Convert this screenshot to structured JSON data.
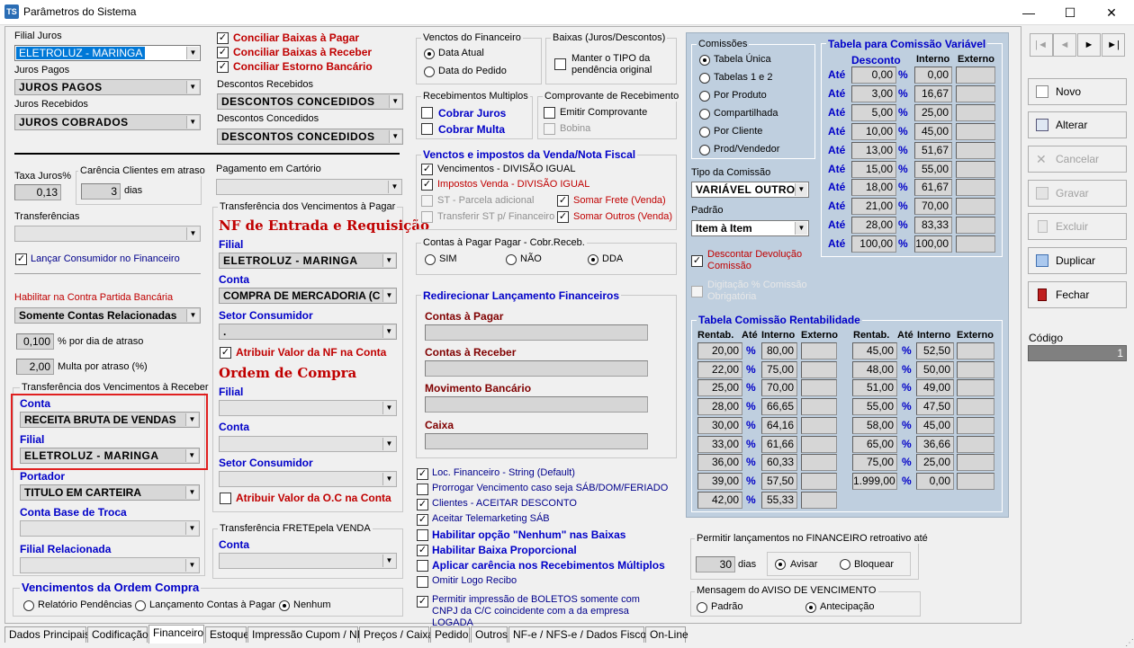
{
  "window": {
    "title": "Parâmetros do Sistema",
    "icon": "TS"
  },
  "left": {
    "filial_juros_label": "Filial Juros",
    "filial_juros": "ELETROLUZ - MARINGA",
    "juros_pagos_label": "Juros Pagos",
    "juros_pagos": "JUROS PAGOS",
    "juros_recebidos_label": "Juros Recebidos",
    "juros_recebidos": "JUROS COBRADOS",
    "conc_pagar": "Conciliar Baixas à Pagar",
    "conc_receber": "Conciliar Baixas à Receber",
    "conc_estorno": "Conciliar Estorno Bancário",
    "desc_recebidos_label": "Descontos Recebidos",
    "desc_recebidos": "DESCONTOS CONCEDIDOS",
    "desc_concedidos_label": "Descontos Concedidos",
    "desc_concedidos": "DESCONTOS CONCEDIDOS",
    "taxa_juros_label": "Taxa Juros%",
    "taxa_juros": "0,13",
    "carencia_label": "Carência Clientes em atraso",
    "carencia": "3",
    "carencia_unit": "dias",
    "pag_cartorio_label": "Pagamento em Cartório",
    "transferencias_label": "Transferências",
    "lancar_consumidor": "Lançar Consumidor no Financeiro",
    "habilitar_contra_label": "Habilitar na Contra Partida Bancária",
    "habilitar_contra": "Somente Contas Relacionadas",
    "por_dia": "0,100",
    "por_dia_label": "% por dia de atraso",
    "multa": "2,00",
    "multa_label": "Multa por atraso (%)",
    "transf_receber_label": "Transferência dos Vencimentos à Receber",
    "conta_label": "Conta",
    "conta": "RECEITA BRUTA DE VENDAS",
    "filial_label": "Filial",
    "filial": "ELETROLUZ - MARINGA",
    "portador_label": "Portador",
    "portador": "TITULO EM CARTEIRA",
    "conta_base_label": "Conta Base de Troca",
    "filial_rel_label": "Filial Relacionada",
    "venc_oc_label": "Vencimentos da Ordem Compra",
    "venc_oc_opts": [
      "Relatório Pendências",
      "Lançamento Contas à Pagar",
      "Nenhum"
    ]
  },
  "pagar": {
    "caption": "Transferência dos Vencimentos à Pagar",
    "nf_title": "NF de Entrada e Requisição",
    "filial_label": "Filial",
    "filial": "ELETROLUZ - MARINGA",
    "conta_label": "Conta",
    "conta": "COMPRA DE MERCADORIA (C",
    "setor_label": "Setor Consumidor",
    "setor": ".",
    "atribuir_nf": "Atribuir Valor da NF na Conta",
    "oc_title": "Ordem de Compra",
    "oc_filial_label": "Filial",
    "oc_conta_label": "Conta",
    "oc_setor_label": "Setor Consumidor",
    "atribuir_oc": "Atribuir Valor da O.C na Conta",
    "frete_caption": "Transferência FRETEpela VENDA",
    "frete_conta_label": "Conta"
  },
  "mid": {
    "venctos_fin": "Venctos do Financeiro",
    "data_atual": "Data Atual",
    "data_pedido": "Data do Pedido",
    "baixas": "Baixas (Juros/Descontos)",
    "manter_tipo": "Manter o TIPO da pendência original",
    "receb_mult": "Recebimentos Multiplos",
    "cobrar_juros": "Cobrar Juros",
    "cobrar_multa": "Cobrar Multa",
    "comprov": "Comprovante de Recebimento",
    "emitir_comp": "Emitir Comprovante",
    "bobina": "Bobina",
    "venctos_impostos": "Venctos e impostos da Venda/Nota Fiscal",
    "vencimentos": "Vencimentos - DIVISÃO IGUAL",
    "impostos": "Impostos Venda - DIVISÃO IGUAL",
    "st_parcela": "ST - Parcela adicional",
    "somar_frete": "Somar Frete (Venda)",
    "transf_st": "Transferir ST p/ Financeiro",
    "somar_outros": "Somar Outros (Venda)",
    "contas_pagar_cobr": "Contas à Pagar Pagar - Cobr.Receb.",
    "sim": "SIM",
    "nao": "NÃO",
    "dda": "DDA",
    "redirecionar": "Redirecionar Lançamento Financeiros",
    "contas_pagar": "Contas à Pagar",
    "contas_receber": "Contas à Receber",
    "mov_bancario": "Movimento Bancário",
    "caixa": "Caixa",
    "checks": [
      "Loc. Financeiro - String (Default)",
      "Prorrogar Vencimento caso seja SÁB/DOM/FERIADO",
      "Clientes - ACEITAR DESCONTO",
      "Aceitar Telemarketing SÁB",
      "Habilitar opção \"Nenhum\" nas Baixas",
      "Habilitar Baixa Proporcional",
      "Aplicar carência nos Recebimentos Múltiplos",
      "Omitir Logo Recibo"
    ],
    "boletos": "Permitir impressão de BOLETOS somente com CNPJ da C/C coincidente com a da  empresa LOGADA"
  },
  "comissao": {
    "caption": "Comissões",
    "opts": [
      "Tabela Única",
      "Tabelas 1 e 2",
      "Por Produto",
      "Compartilhada",
      "Por Cliente",
      "Prod/Vendedor"
    ],
    "tipo_label": "Tipo da Comissão",
    "tipo": "VARIÁVEL OUTRO",
    "padrao_label": "Padrão",
    "padrao": "Item à Item",
    "descontar": "Descontar Devolução Comissão",
    "digitacao": "Digitação % Comissão Obrigatória",
    "var_title": "Tabela para Comissão Variável",
    "h_desc": "Desconto",
    "h_int": "Interno",
    "h_ext": "Externo",
    "ate": "Até",
    "pct": "%",
    "rows": [
      [
        "0,00",
        "0,00"
      ],
      [
        "3,00",
        "16,67"
      ],
      [
        "5,00",
        "25,00"
      ],
      [
        "10,00",
        "45,00"
      ],
      [
        "13,00",
        "51,67"
      ],
      [
        "15,00",
        "55,00"
      ],
      [
        "18,00",
        "61,67"
      ],
      [
        "21,00",
        "70,00"
      ],
      [
        "28,00",
        "83,33"
      ],
      [
        "100,00",
        "100,00"
      ]
    ],
    "rent_title": "Tabela Comissão Rentabilidade",
    "h_rent": "Rentab.",
    "rent_left": [
      [
        "20,00",
        "80,00"
      ],
      [
        "22,00",
        "75,00"
      ],
      [
        "25,00",
        "70,00"
      ],
      [
        "28,00",
        "66,65"
      ],
      [
        "30,00",
        "64,16"
      ],
      [
        "33,00",
        "61,66"
      ],
      [
        "36,00",
        "60,33"
      ],
      [
        "39,00",
        "57,50"
      ],
      [
        "42,00",
        "55,33"
      ]
    ],
    "rent_right": [
      [
        "45,00",
        "52,50"
      ],
      [
        "48,00",
        "50,00"
      ],
      [
        "51,00",
        "49,00"
      ],
      [
        "55,00",
        "47,50"
      ],
      [
        "58,00",
        "45,00"
      ],
      [
        "65,00",
        "36,66"
      ],
      [
        "75,00",
        "25,00"
      ],
      [
        "1.999,00",
        "0,00"
      ]
    ],
    "retro_label": "Permitir lançamentos no FINANCEIRO retroativo até",
    "retro": "30",
    "retro_unit": "dias",
    "avisar": "Avisar",
    "bloquear": "Bloquear",
    "aviso_label": "Mensagem do AVISO DE VENCIMENTO",
    "padrao_opt": "Padrão",
    "antecip": "Antecipação"
  },
  "buttons": {
    "novo": "Novo",
    "alterar": "Alterar",
    "cancelar": "Cancelar",
    "gravar": "Gravar",
    "excluir": "Excluir",
    "duplicar": "Duplicar",
    "fechar": "Fechar",
    "codigo_label": "Código",
    "codigo": "1"
  },
  "nav": [
    "|◄",
    "◄",
    "►",
    "►|"
  ],
  "tabs": [
    "Dados Principais",
    "Codificação",
    "Financeiro",
    "Estoque",
    "Impressão Cupom / NF",
    "Preços / Caixa",
    "Pedido",
    "Outros",
    "NF-e / NFS-e / Dados Fisco",
    "On-Line"
  ]
}
